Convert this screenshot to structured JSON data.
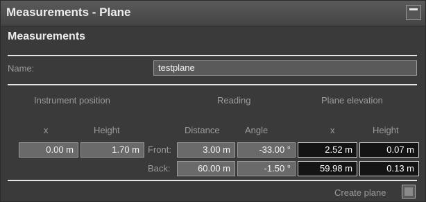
{
  "window": {
    "title": "Measurements - Plane"
  },
  "section": {
    "title": "Measurements"
  },
  "name": {
    "label": "Name:",
    "value": "testplane"
  },
  "groups": {
    "instrument_position": "Instrument position",
    "reading": "Reading",
    "plane_elevation": "Plane elevation"
  },
  "columns": {
    "x": "x",
    "height": "Height",
    "distance": "Distance",
    "angle": "Angle",
    "elev_x": "x",
    "elev_height": "Height"
  },
  "instrument": {
    "x": "0.00 m",
    "height": "1.70 m"
  },
  "front": {
    "label": "Front:",
    "distance": "3.00 m",
    "angle": "-33.00 °",
    "elev_x": "2.52 m",
    "elev_height": "0.07 m"
  },
  "back": {
    "label": "Back:",
    "distance": "60.00 m",
    "angle": "-1.50 °",
    "elev_x": "59.98 m",
    "elev_height": "0.13 m"
  },
  "create_plane": {
    "label": "Create plane"
  }
}
